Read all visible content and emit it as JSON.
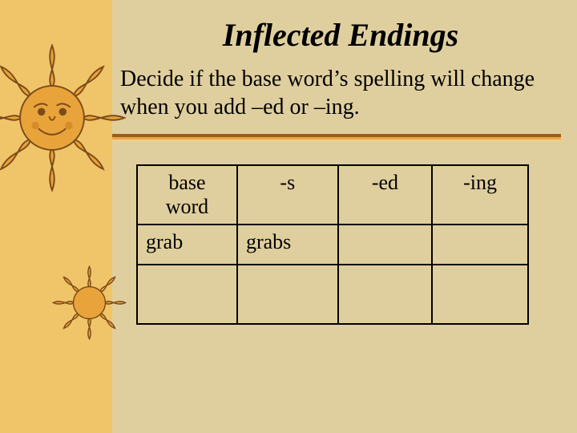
{
  "title": "Inflected Endings",
  "subtitle": "Decide if the base word’s spelling will change when you add –ed or –ing.",
  "table": {
    "headers": {
      "col0": "base word",
      "col1": "-s",
      "col2": "-ed",
      "col3": "-ing"
    },
    "rows": [
      {
        "col0": "grab",
        "col1": "grabs",
        "col2": "",
        "col3": ""
      }
    ]
  },
  "colors": {
    "sidebar": "#f0c468",
    "background": "#e0cf9e",
    "sun_fill": "#e8a43a",
    "sun_stroke": "#7a4a1a"
  }
}
